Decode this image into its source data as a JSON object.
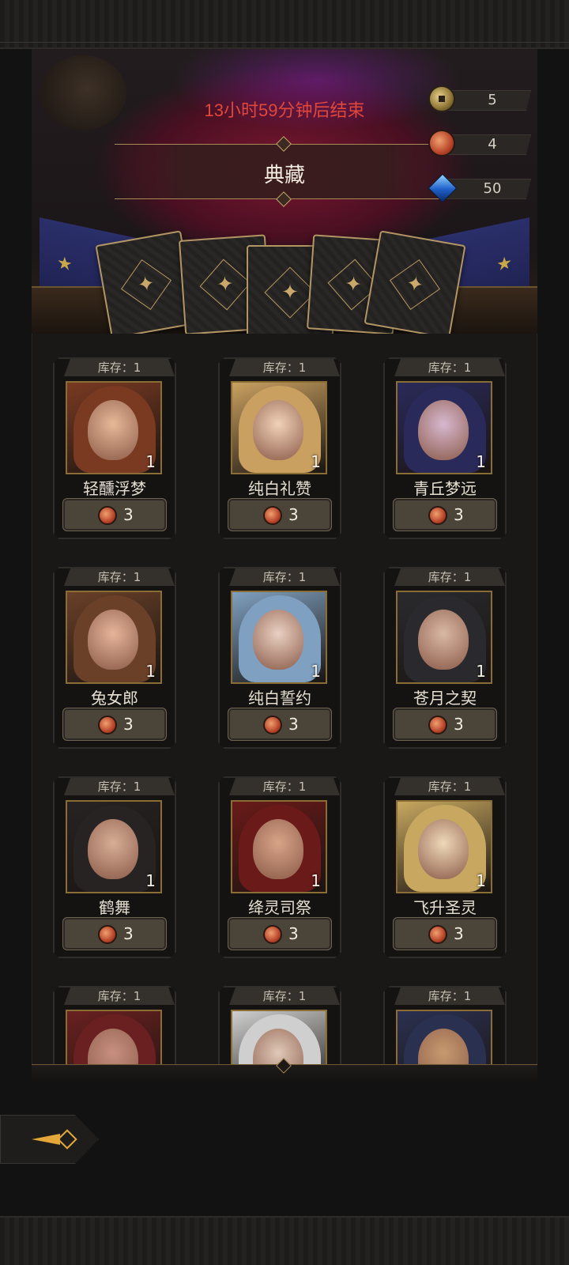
{
  "event": {
    "timer_text": "13小时59分钟后结束",
    "title": "典藏"
  },
  "currencies": [
    {
      "name": "coin",
      "icon": "gold-coin-icon",
      "value": "5"
    },
    {
      "name": "token",
      "icon": "copper-token-icon",
      "value": "4"
    },
    {
      "name": "gem",
      "icon": "blue-gem-icon",
      "value": "50"
    }
  ],
  "shop": {
    "items": [
      {
        "stock": "库存：1",
        "name": "轻醺浮梦",
        "qty": "1",
        "price": "3",
        "palette": [
          "#7a3a22",
          "#e8b898"
        ]
      },
      {
        "stock": "库存：1",
        "name": "纯白礼赞",
        "qty": "1",
        "price": "3",
        "palette": [
          "#c9a060",
          "#f2d2b8"
        ]
      },
      {
        "stock": "库存：1",
        "name": "青丘梦远",
        "qty": "1",
        "price": "3",
        "palette": [
          "#2a2a5a",
          "#d8b8d0"
        ]
      },
      {
        "stock": "库存：1",
        "name": "兔女郎",
        "qty": "1",
        "price": "3",
        "palette": [
          "#6a4028",
          "#e6b49a"
        ]
      },
      {
        "stock": "库存：1",
        "name": "纯白誓约",
        "qty": "1",
        "price": "3",
        "palette": [
          "#7fa0c0",
          "#ead0c2"
        ]
      },
      {
        "stock": "库存：1",
        "name": "苍月之契",
        "qty": "1",
        "price": "3",
        "palette": [
          "#2a2a2e",
          "#d9b8a4"
        ]
      },
      {
        "stock": "库存：1",
        "name": "鹤舞",
        "qty": "1",
        "price": "3",
        "palette": [
          "#262322",
          "#d7ae96"
        ]
      },
      {
        "stock": "库存：1",
        "name": "绛灵司祭",
        "qty": "1",
        "price": "3",
        "palette": [
          "#6a1a18",
          "#d8a488"
        ]
      },
      {
        "stock": "库存：1",
        "name": "飞升圣灵",
        "qty": "1",
        "price": "3",
        "palette": [
          "#c8a860",
          "#f0d8b8"
        ]
      },
      {
        "stock": "库存：1",
        "name": "",
        "qty": "",
        "price": "",
        "palette": [
          "#6a2020",
          "#c89080"
        ]
      },
      {
        "stock": "库存：1",
        "name": "",
        "qty": "",
        "price": "",
        "palette": [
          "#cfcfcf",
          "#e0c8b8"
        ]
      },
      {
        "stock": "库存：1",
        "name": "",
        "qty": "",
        "price": "",
        "palette": [
          "#2a3050",
          "#c89a70"
        ]
      }
    ]
  }
}
